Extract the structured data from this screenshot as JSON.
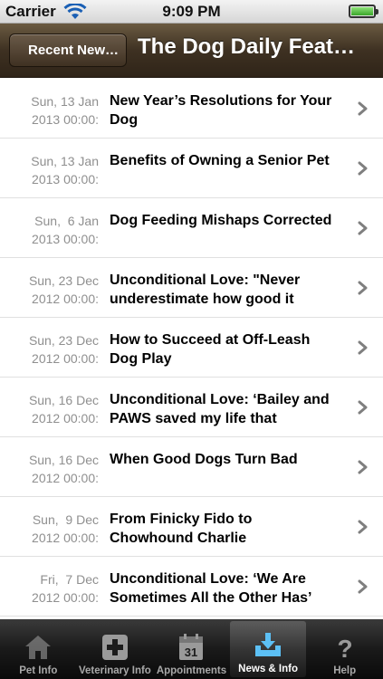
{
  "status_bar": {
    "carrier": "Carrier",
    "time": "9:09 PM",
    "battery_level": 1.0
  },
  "nav": {
    "back_label": "Recent New…",
    "title": "The Dog Daily Feat…"
  },
  "articles": [
    {
      "date_line1": "Sun, 13 Jan",
      "date_line2": "2013 00:00:",
      "title": "New Year’s Resolutions for Your Dog"
    },
    {
      "date_line1": "Sun, 13 Jan",
      "date_line2": "2013 00:00:",
      "title": "Benefits of Owning a Senior Pet"
    },
    {
      "date_line1": "Sun,  6 Jan",
      "date_line2": "2013 00:00:",
      "title": "Dog Feeding Mishaps Corrected"
    },
    {
      "date_line1": "Sun, 23 Dec",
      "date_line2": "2012 00:00:",
      "title": "Unconditional Love: \"Never underestimate how good it"
    },
    {
      "date_line1": "Sun, 23 Dec",
      "date_line2": "2012 00:00:",
      "title": "How to Succeed at Off-Leash Dog Play"
    },
    {
      "date_line1": "Sun, 16 Dec",
      "date_line2": "2012 00:00:",
      "title": "Unconditional Love: ‘Bailey and PAWS saved my life that"
    },
    {
      "date_line1": "Sun, 16 Dec",
      "date_line2": "2012 00:00:",
      "title": "When Good Dogs Turn Bad"
    },
    {
      "date_line1": "Sun,  9 Dec",
      "date_line2": "2012 00:00:",
      "title": "From Finicky Fido to Chowhound Charlie"
    },
    {
      "date_line1": "Fri,  7 Dec",
      "date_line2": "2012 00:00:",
      "title": "Unconditional Love: ‘We Are Sometimes All the Other Has’"
    }
  ],
  "tabs": [
    {
      "label": "Pet Info",
      "icon": "house-icon"
    },
    {
      "label": "Veterinary Info",
      "icon": "medical-cross-icon"
    },
    {
      "label": "Appointments",
      "icon": "calendar-icon",
      "icon_text": "31"
    },
    {
      "label": "News & Info",
      "icon": "download-tray-icon",
      "active": true
    },
    {
      "label": "Help",
      "icon": "question-mark-icon"
    }
  ]
}
